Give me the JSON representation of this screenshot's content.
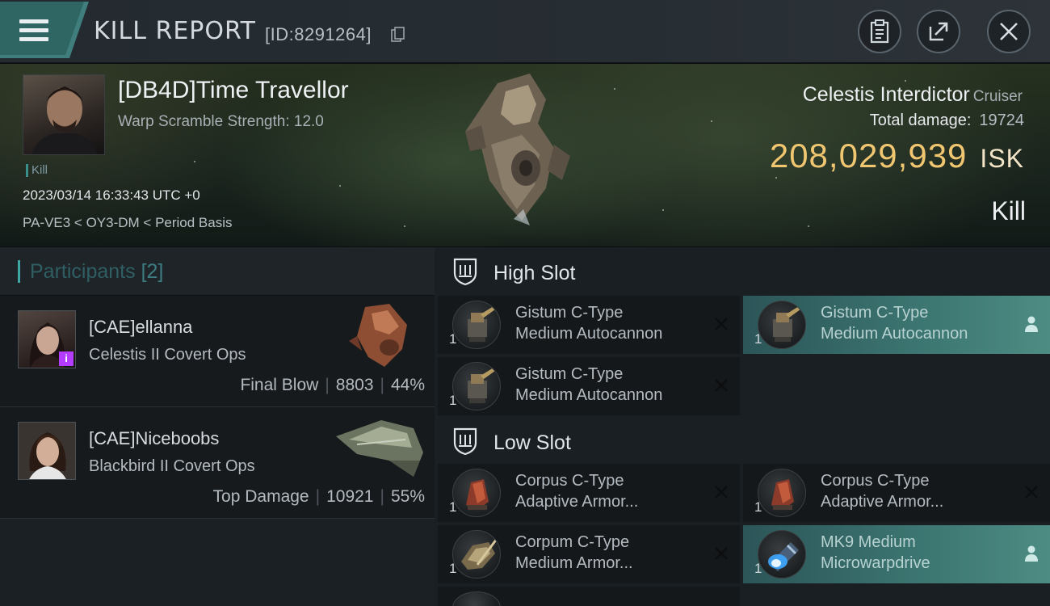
{
  "header": {
    "title": "KILL REPORT",
    "report_id": "[ID:8291264]"
  },
  "victim": {
    "name": "[DB4D]Time Travellor",
    "subtitle": "Warp Scramble Strength: 12.0",
    "tag": "Kill",
    "timestamp": "2023/03/14 16:33:43 UTC +0",
    "location": "PA-VE3 < OY3-DM < Period Basis",
    "ship_name": "Celestis Interdictor",
    "ship_class": "Cruiser",
    "total_damage_label": "Total damage:",
    "total_damage": "19724",
    "isk_value": "208,029,939",
    "isk_unit": "ISK",
    "result": "Kill"
  },
  "participants": {
    "label": "Participants",
    "count": "[2]",
    "list": [
      {
        "name": "[CAE]ellanna",
        "ship": "Celestis II Covert Ops",
        "role": "Final Blow",
        "damage": "8803",
        "percent": "44%"
      },
      {
        "name": "[CAE]Niceboobs",
        "ship": "Blackbird II Covert Ops",
        "role": "Top Damage",
        "damage": "10921",
        "percent": "55%"
      }
    ]
  },
  "slots": {
    "high": {
      "label": "High Slot",
      "modules": [
        {
          "line1": "Gistum C-Type",
          "line2": "Medium Autocannon",
          "qty": "1",
          "action": "remove",
          "highlight": false
        },
        {
          "line1": "Gistum C-Type",
          "line2": "Medium Autocannon",
          "qty": "1",
          "action": "person",
          "highlight": true
        },
        {
          "line1": "Gistum C-Type",
          "line2": "Medium Autocannon",
          "qty": "1",
          "action": "remove",
          "highlight": false
        }
      ]
    },
    "low": {
      "label": "Low Slot",
      "modules": [
        {
          "line1": "Corpus C-Type",
          "line2": "Adaptive Armor...",
          "qty": "1",
          "action": "remove",
          "highlight": false
        },
        {
          "line1": "Corpus C-Type",
          "line2": "Adaptive Armor...",
          "qty": "1",
          "action": "remove",
          "highlight": false
        },
        {
          "line1": "Corpum C-Type",
          "line2": "Medium Armor...",
          "qty": "1",
          "action": "remove",
          "highlight": false
        },
        {
          "line1": "MK9 Medium",
          "line2": "Microwarpdrive",
          "qty": "1",
          "action": "person",
          "highlight": true
        }
      ]
    }
  },
  "icons": {
    "menu": "hamburger-icon",
    "copy": "copy-icon",
    "clipboard": "clipboard-icon",
    "share": "share-icon",
    "close": "close-icon",
    "slot": "shield-slot-icon",
    "remove": "x-icon",
    "person": "person-icon"
  },
  "colors": {
    "isk": "#f0c670",
    "accent_teal": "#3ea7a4",
    "highlight_row": "#3b7470",
    "corp_badge": "#b43cff"
  }
}
